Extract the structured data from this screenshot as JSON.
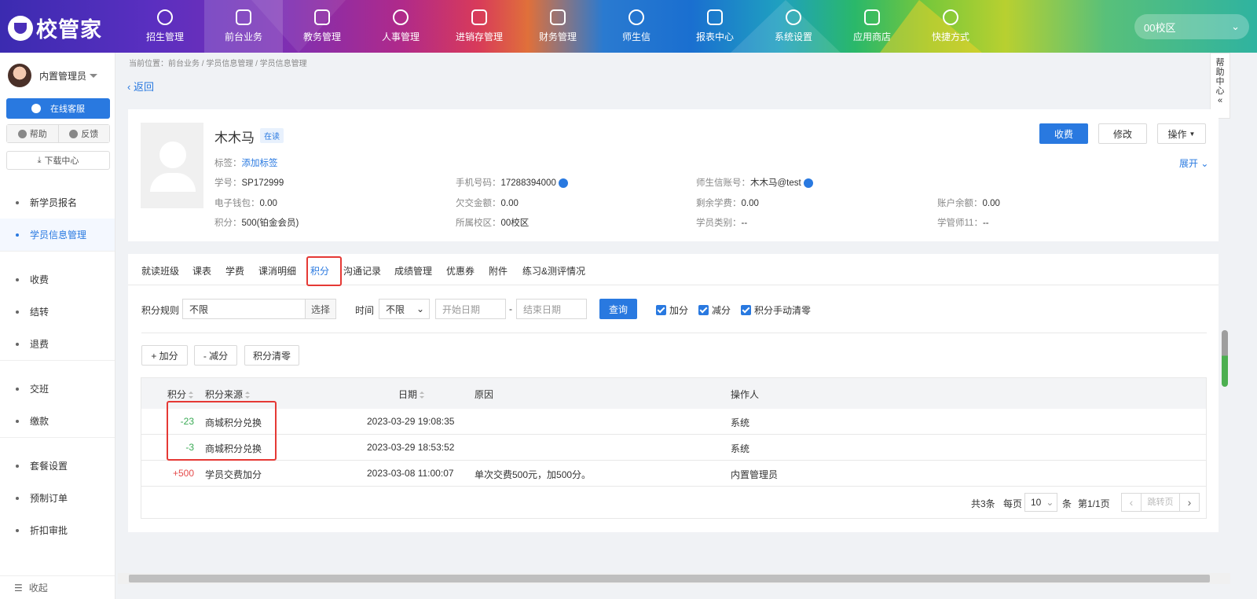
{
  "app": {
    "logo": "校管家",
    "campus": "00校区"
  },
  "nav": [
    "招生管理",
    "前台业务",
    "教务管理",
    "人事管理",
    "进销存管理",
    "财务管理",
    "师生信",
    "报表中心",
    "系统设置",
    "应用商店",
    "快捷方式"
  ],
  "sidebar": {
    "user": "内置管理员",
    "online_service": "在线客服",
    "help": "帮助",
    "feedback": "反馈",
    "download": "下载中心",
    "menu_a": [
      "新学员报名",
      "学员信息管理"
    ],
    "menu_b": [
      "收费",
      "结转",
      "退费"
    ],
    "menu_c": [
      "交班",
      "缴款"
    ],
    "menu_d": [
      "套餐设置",
      "预制订单",
      "折扣审批"
    ],
    "collapse": "收起"
  },
  "breadcrumb": "当前位置：前台业务 / 学员信息管理 / 学员信息管理",
  "back": "返回",
  "help_center": "帮助中心",
  "student": {
    "name": "木木马",
    "status": "在读",
    "tags_label": "标签：",
    "tags_link": "添加标签",
    "id_label": "学号：",
    "id": "SP172999",
    "phone_label": "手机号码：",
    "phone": "17288394000",
    "account_label": "师生信账号：",
    "account": "木木马@test",
    "wallet_label": "电子钱包：",
    "wallet": "0.00",
    "owed_label": "欠交金额：",
    "owed": "0.00",
    "remain_label": "剩余学费：",
    "remain": "0.00",
    "balance_label": "账户余额：",
    "balance": "0.00",
    "points_label": "积分：",
    "points": "500(铂金会员)",
    "campus_label": "所属校区：",
    "campus": "00校区",
    "category_label": "学员类别：",
    "category": "--",
    "manager_label": "学管师11：",
    "manager": "--"
  },
  "actions": {
    "charge": "收费",
    "edit": "修改",
    "ops": "操作",
    "expand": "展开"
  },
  "tabs": [
    "就读班级",
    "课表",
    "学费",
    "课消明细",
    "积分",
    "沟通记录",
    "成绩管理",
    "优惠券",
    "附件",
    "练习&测评情况"
  ],
  "active_tab": "积分",
  "filter": {
    "rule_label": "积分规则",
    "rule_value": "不限",
    "choose": "选择",
    "time_label": "时间",
    "time_value": "不限",
    "start_placeholder": "开始日期",
    "dash": "-",
    "end_placeholder": "结束日期",
    "query": "查询",
    "chk_add": "加分",
    "chk_sub": "减分",
    "chk_clear": "积分手动清零"
  },
  "buttons": {
    "add": "+ 加分",
    "sub": "- 减分",
    "clear": "积分清零"
  },
  "table": {
    "headers": {
      "points": "积分",
      "source": "积分来源",
      "date": "日期",
      "reason": "原因",
      "operator": "操作人"
    },
    "rows": [
      {
        "points": "-23",
        "source": "商城积分兑换",
        "date": "2023-03-29 19:08:35",
        "reason": "",
        "operator": "系统"
      },
      {
        "points": "-3",
        "source": "商城积分兑换",
        "date": "2023-03-29 18:53:52",
        "reason": "",
        "operator": "系统"
      },
      {
        "points": "+500",
        "source": "学员交费加分",
        "date": "2023-03-08 11:00:07",
        "reason": "单次交费500元，加500分。",
        "operator": "内置管理员"
      }
    ]
  },
  "pager": {
    "total": "共3条",
    "per_page": "每页",
    "size": "10",
    "unit": "条",
    "page": "第1/1页",
    "jump": "跳转页"
  },
  "colors": {
    "accent": "#2979e0",
    "negative": "#3aaa55",
    "positive": "#e54b4b",
    "highlight": "#e53935"
  }
}
